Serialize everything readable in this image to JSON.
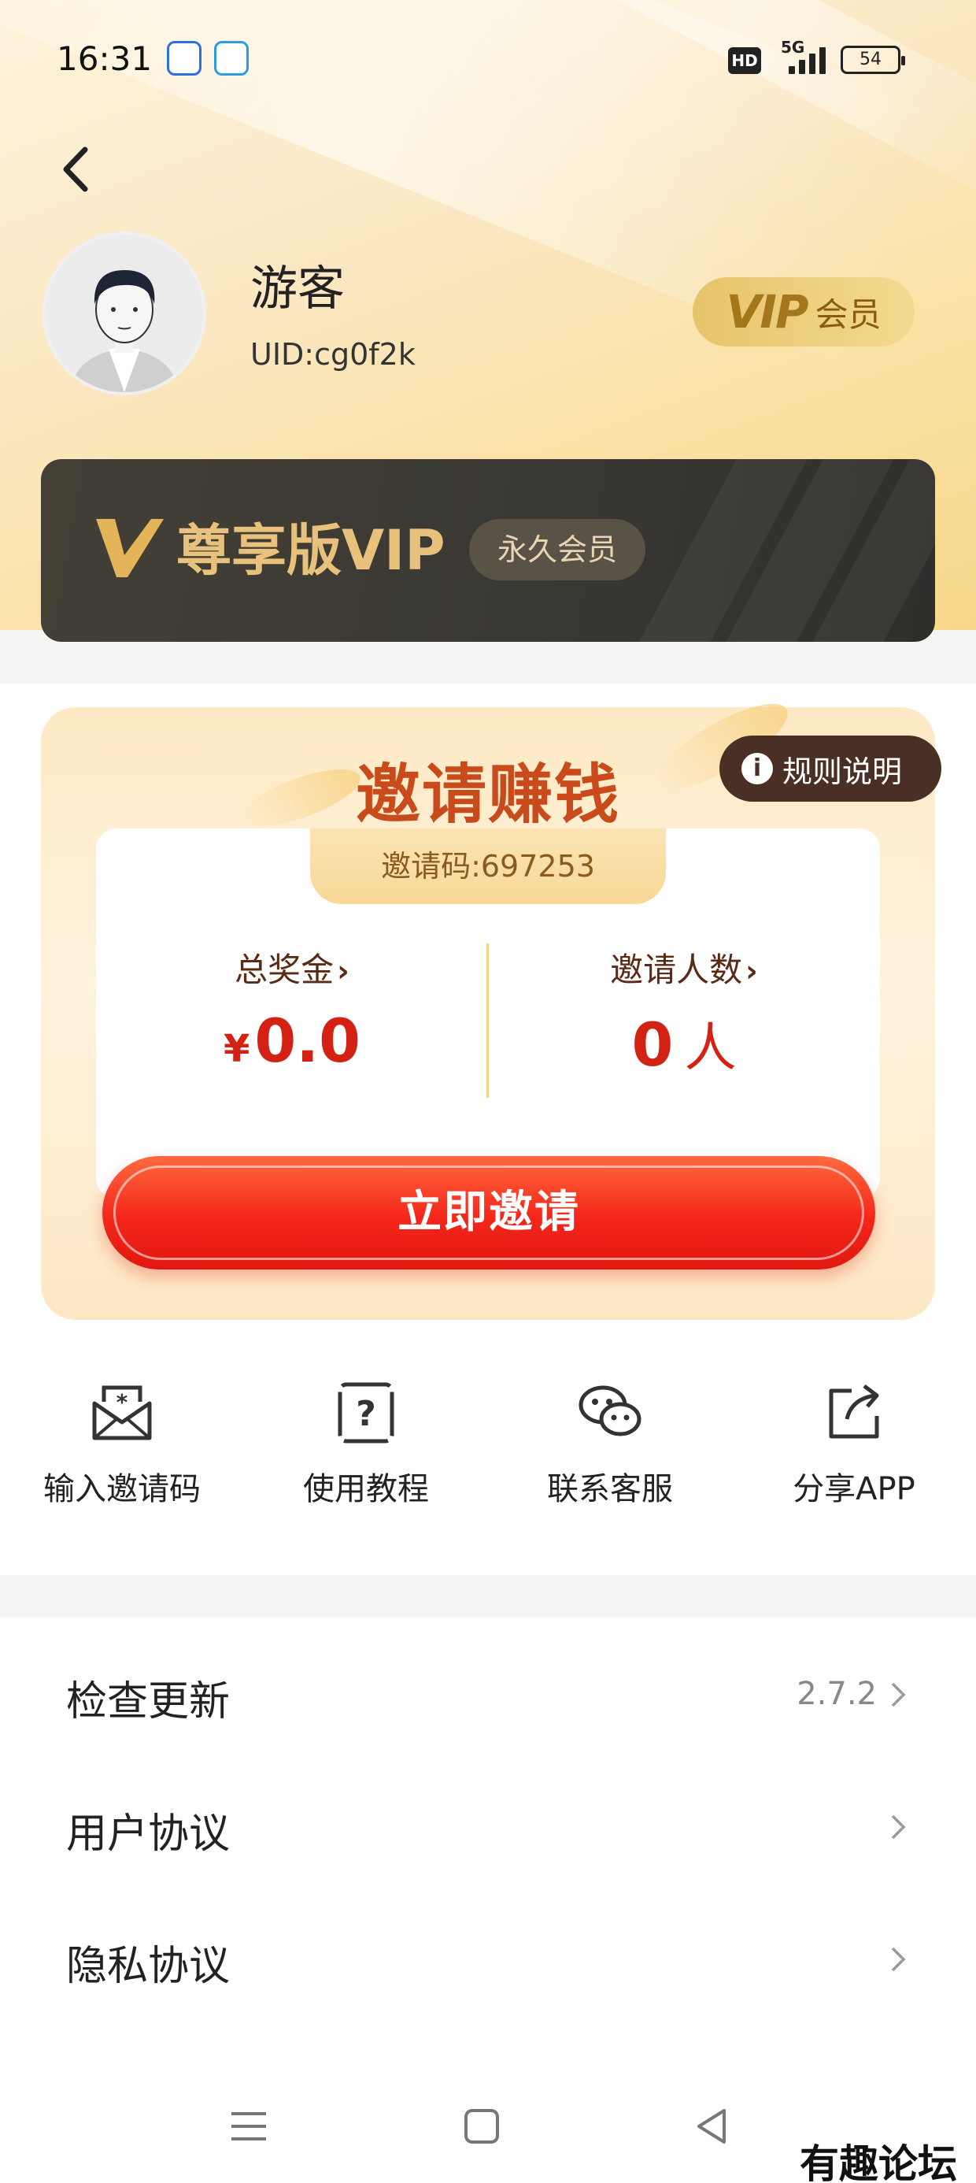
{
  "status_bar": {
    "time": "16:31",
    "hd": "HD",
    "network": "5G",
    "battery": "54"
  },
  "profile": {
    "name": "游客",
    "uid": "UID:cg0f2k",
    "vip_badge_v": "VIP",
    "vip_badge_text": "会员"
  },
  "vip_card": {
    "title": "尊享版VIP",
    "chip": "永久会员"
  },
  "invite": {
    "title": "邀请赚钱",
    "rules_label": "规则说明",
    "code_text": "邀请码:697253",
    "bonus_label": "总奖金",
    "currency": "¥",
    "bonus_value": "0.0",
    "count_label": "邀请人数",
    "count_value": "0",
    "count_unit": "人",
    "button_label": "立即邀请"
  },
  "quick_actions": [
    {
      "label": "输入邀请码",
      "icon": "envelope-star-icon"
    },
    {
      "label": "使用教程",
      "icon": "question-doc-icon"
    },
    {
      "label": "联系客服",
      "icon": "wechat-icon"
    },
    {
      "label": "分享APP",
      "icon": "share-icon"
    }
  ],
  "settings": [
    {
      "label": "检查更新",
      "value": "2.7.2"
    },
    {
      "label": "用户协议",
      "value": ""
    },
    {
      "label": "隐私协议",
      "value": ""
    }
  ],
  "watermark": "有趣论坛",
  "colors": {
    "accent_red": "#f4261a",
    "gold": "#e8c17c",
    "brown": "#4a3024"
  }
}
